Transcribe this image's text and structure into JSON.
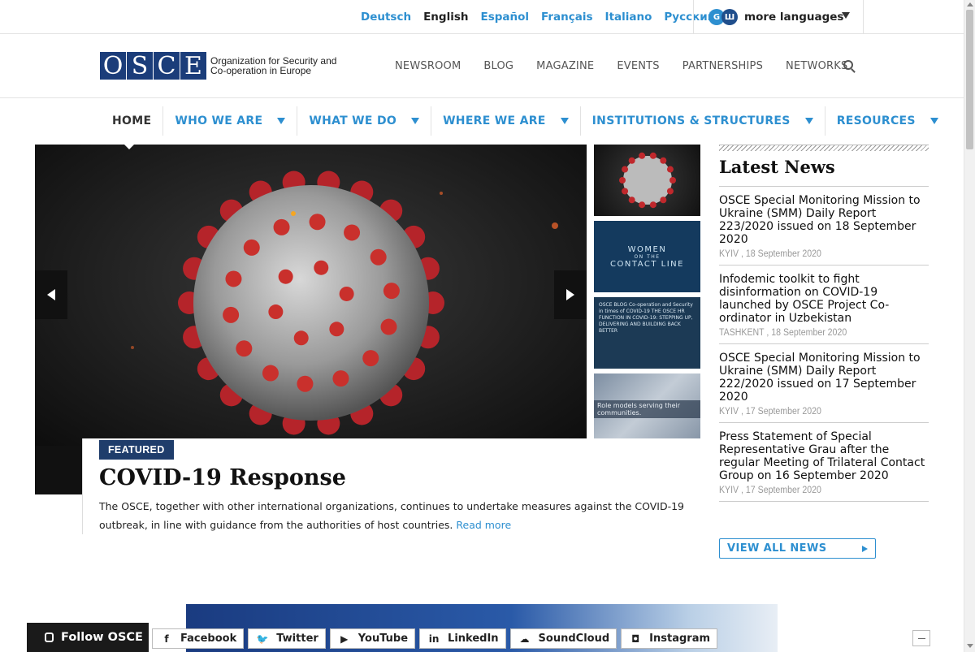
{
  "languages": {
    "items": [
      "Deutsch",
      "English",
      "Español",
      "Français",
      "Italiano",
      "Русский"
    ],
    "active": "English",
    "more_label": "more languages",
    "globe_letters": [
      "G",
      "Ш"
    ]
  },
  "logo": {
    "letters": [
      "O",
      "S",
      "C",
      "E"
    ],
    "text": "Organization for Security and Co-operation in Europe"
  },
  "top_nav": [
    "NEWSROOM",
    "BLOG",
    "MAGAZINE",
    "EVENTS",
    "PARTNERSHIPS",
    "NETWORKS"
  ],
  "main_nav": [
    {
      "label": "HOME",
      "dropdown": false
    },
    {
      "label": "WHO WE ARE",
      "dropdown": true
    },
    {
      "label": "WHAT WE DO",
      "dropdown": true
    },
    {
      "label": "WHERE WE ARE",
      "dropdown": true
    },
    {
      "label": "INSTITUTIONS & STRUCTURES",
      "dropdown": true
    },
    {
      "label": "RESOURCES",
      "dropdown": true
    }
  ],
  "featured": {
    "badge": "FEATURED",
    "title": "COVID-19 Response",
    "text": "The OSCE, together with other international organizations, continues to undertake measures against the COVID-19 outbreak, in line with guidance from the authorities of host countries.",
    "read_more": "Read more"
  },
  "thumbnails": {
    "t2_line1": "WOMEN",
    "t2_line2": "ON THE",
    "t2_line3": "CONTACT LINE",
    "t3_text": "OSCE BLOG  Co-operation and Security in times of COVID-19  THE OSCE HR FUNCTION IN COVID-19: STEPPING UP, DELIVERING AND BUILDING BACK BETTER",
    "t4_text": "Role models serving their communities."
  },
  "news": {
    "heading": "Latest News",
    "items": [
      {
        "title": "OSCE Special Monitoring Mission to Ukraine (SMM) Daily Report 223/2020 issued on 18 September 2020",
        "meta": "KYIV , 18 September 2020"
      },
      {
        "title": "Infodemic toolkit to fight disinformation on COVID-19 launched by OSCE Project Co-ordinator in Uzbekistan",
        "meta": "TASHKENT , 18 September 2020"
      },
      {
        "title": "OSCE Special Monitoring Mission to Ukraine (SMM) Daily Report 222/2020 issued on 17 September 2020",
        "meta": "KYIV , 17 September 2020"
      },
      {
        "title": "Press Statement of Special Representative Grau after the regular Meeting of Trilateral Contact Group on 16 September 2020",
        "meta": "KYIV , 17 September 2020"
      }
    ],
    "view_all": "VIEW ALL NEWS"
  },
  "social": {
    "follow_label": "Follow OSCE",
    "items": [
      {
        "label": "Facebook",
        "icon": "f"
      },
      {
        "label": "Twitter",
        "icon": "🐦"
      },
      {
        "label": "YouTube",
        "icon": "▶"
      },
      {
        "label": "LinkedIn",
        "icon": "in"
      },
      {
        "label": "SoundCloud",
        "icon": "☁"
      },
      {
        "label": "Instagram",
        "icon": "◘"
      }
    ]
  },
  "colors": {
    "accent": "#2d8fd0",
    "brand_navy": "#1b3d7a",
    "badge": "#1f3d6b"
  }
}
